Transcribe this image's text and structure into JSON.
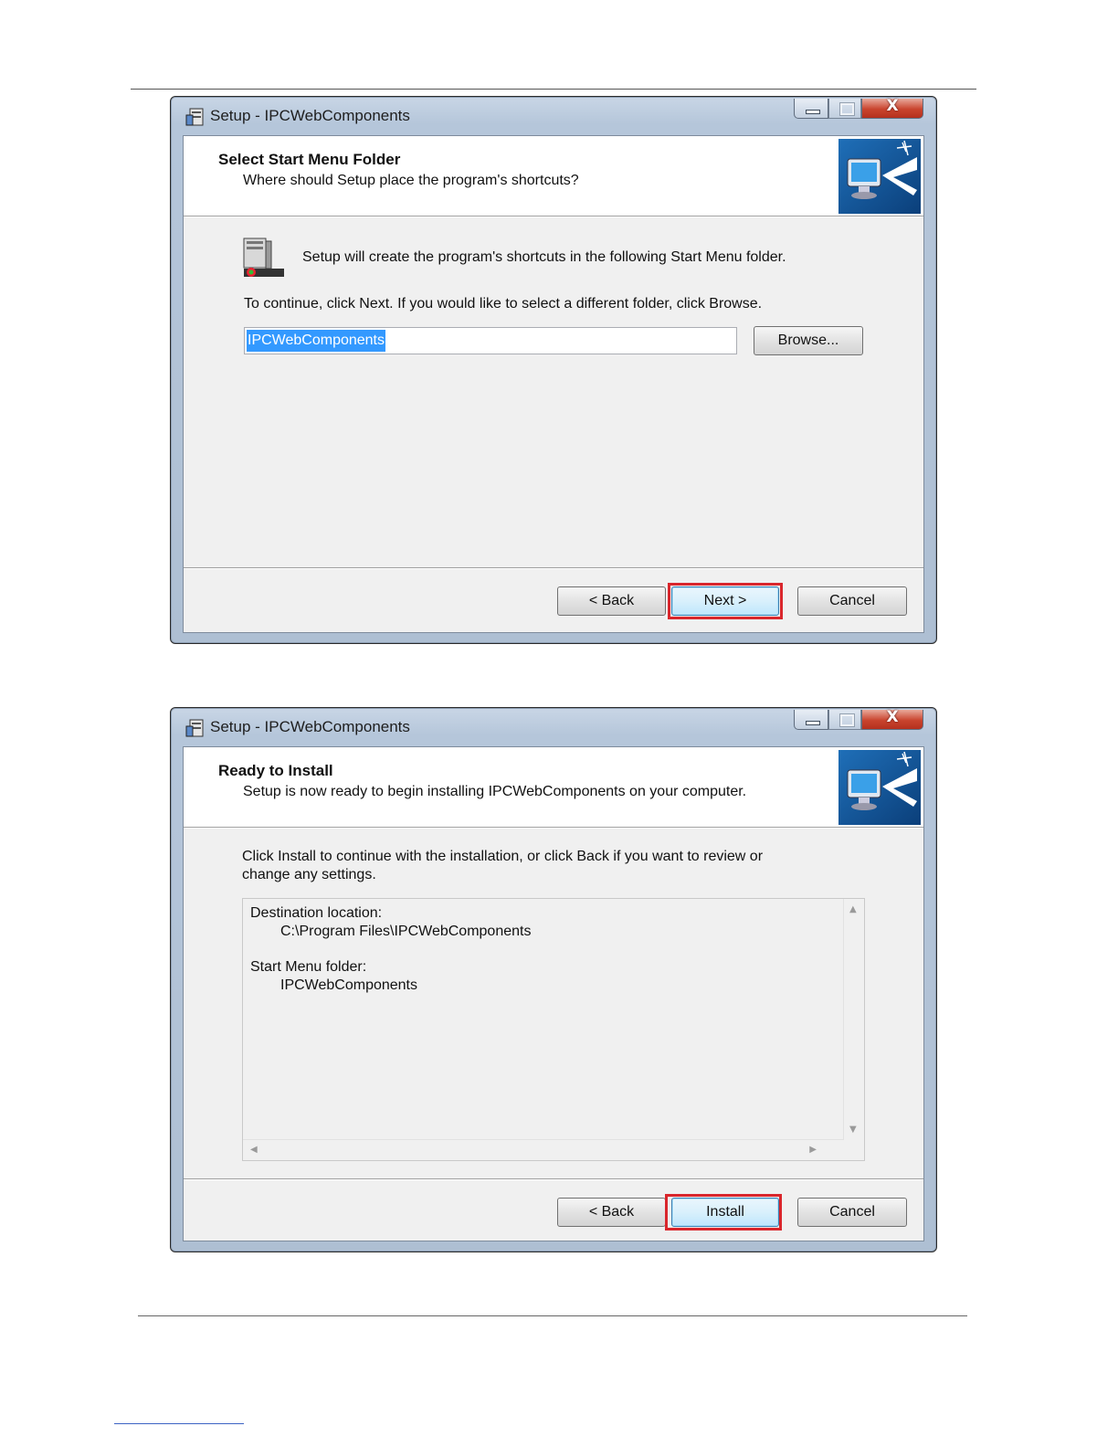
{
  "dialog1": {
    "title": "Setup - IPCWebComponents",
    "close_glyph": "X",
    "header_title": "Select Start Menu Folder",
    "header_subtitle": "Where should Setup place the program's shortcuts?",
    "info_text": "Setup will create the program's shortcuts in the following Start Menu folder.",
    "instruction_text": "To continue, click Next. If you would like to select a different folder, click Browse.",
    "folder_value": "IPCWebComponents",
    "browse_label": "Browse...",
    "back_label": "< Back",
    "next_label": "Next >",
    "cancel_label": "Cancel",
    "highlight_color": "#d9262c"
  },
  "dialog2": {
    "title": "Setup - IPCWebComponents",
    "close_glyph": "X",
    "header_title": "Ready to Install",
    "header_subtitle": "Setup is now ready to begin installing IPCWebComponents on your computer.",
    "instruction_line1": "Click Install to continue with the installation, or click Back if you want to review or",
    "instruction_line2": "change any settings.",
    "memo": {
      "dest_label": "Destination location:",
      "dest_value": "C:\\Program Files\\IPCWebComponents",
      "menu_label": "Start Menu folder:",
      "menu_value": "IPCWebComponents"
    },
    "back_label": "< Back",
    "install_label": "Install",
    "cancel_label": "Cancel",
    "highlight_color": "#d9262c"
  },
  "icons": {
    "app": "setup-app-icon",
    "wizard": "computer-wizard-icon",
    "folder": "start-menu-folder-icon",
    "scroll_up": "▲",
    "scroll_down": "▼",
    "scroll_left": "◀",
    "scroll_right": "▶"
  }
}
